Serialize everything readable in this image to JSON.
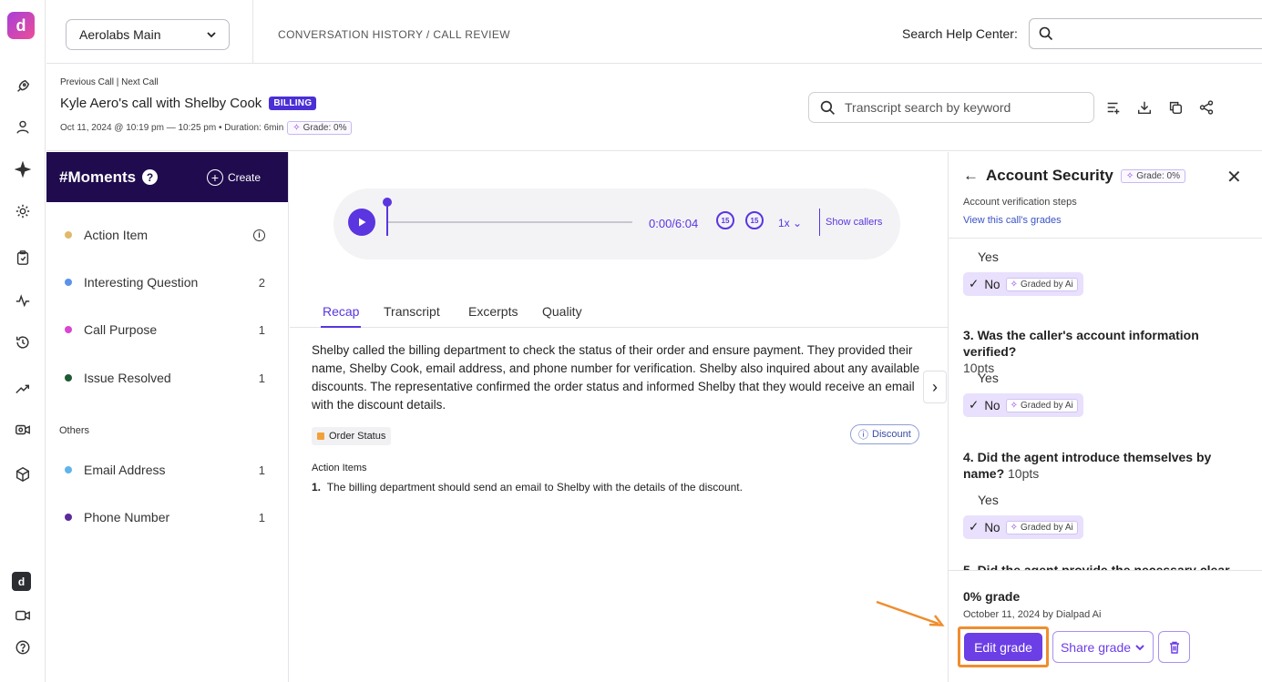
{
  "app": {
    "logo_letter": "d"
  },
  "topbar": {
    "workspace": "Aerolabs Main",
    "breadcrumb": "CONVERSATION HISTORY / CALL REVIEW",
    "help_label": "Search Help Center:"
  },
  "call": {
    "prev": "Previous Call",
    "next": "Next Call",
    "title": "Kyle Aero's call with Shelby Cook",
    "tag": "BILLING",
    "meta": "Oct 11, 2024 @ 10:19 pm — 10:25 pm • Duration: 6min",
    "grade": "Grade: 0%",
    "search_placeholder": "Transcript search by keyword"
  },
  "moments": {
    "title": "#Moments",
    "create": "Create",
    "items": [
      {
        "label": "Action Item",
        "count": "",
        "color": "#e0b96a"
      },
      {
        "label": "Interesting Question",
        "count": "2",
        "color": "#5b93ea"
      },
      {
        "label": "Call Purpose",
        "count": "1",
        "color": "#d946d2"
      },
      {
        "label": "Issue Resolved",
        "count": "1",
        "color": "#1f5a34"
      }
    ],
    "others_label": "Others",
    "others": [
      {
        "label": "Email Address",
        "count": "1",
        "color": "#5fb4ea"
      },
      {
        "label": "Phone Number",
        "count": "1",
        "color": "#5b2a9c"
      }
    ]
  },
  "player": {
    "time": "0:00/6:04",
    "skip_back": "15",
    "skip_fwd": "15",
    "speed": "1x",
    "show_callers": "Show callers",
    "progress": 0
  },
  "tabs": [
    "Recap",
    "Transcript",
    "Excerpts",
    "Quality"
  ],
  "recap": {
    "text": "Shelby called the billing department to check the status of their order and ensure payment. They provided their name, Shelby Cook, email address, and phone number for verification. Shelby also inquired about any available discounts. The representative confirmed the order status and informed Shelby that they would receive an email with the discount details.",
    "chip_order": "Order Status",
    "chip_discount": "Discount",
    "action_items_title": "Action Items",
    "action_items": [
      "The billing department should send an email to Shelby with the details of the discount."
    ]
  },
  "panel": {
    "title": "Account Security",
    "grade": "Grade: 0%",
    "subtitle": "Account verification steps",
    "link": "View this call's grades",
    "graded_by": "Graded by Ai",
    "yes": "Yes",
    "no": "No",
    "q3": "3. Was the caller's account information verified?",
    "q3_pts": "10pts",
    "q4": "4. Did the agent introduce themselves by name?",
    "q4_pts": "10pts",
    "q5_partial": "5. Did the agent provide the necessary clear...",
    "footer_grade": "0% grade",
    "footer_date": "October 11, 2024 by Dialpad Ai",
    "edit": "Edit grade",
    "share": "Share grade"
  },
  "colors": {
    "accent": "#5a35e0",
    "brand_dark": "#1f0b4e",
    "highlight": "#ef8d2e"
  }
}
